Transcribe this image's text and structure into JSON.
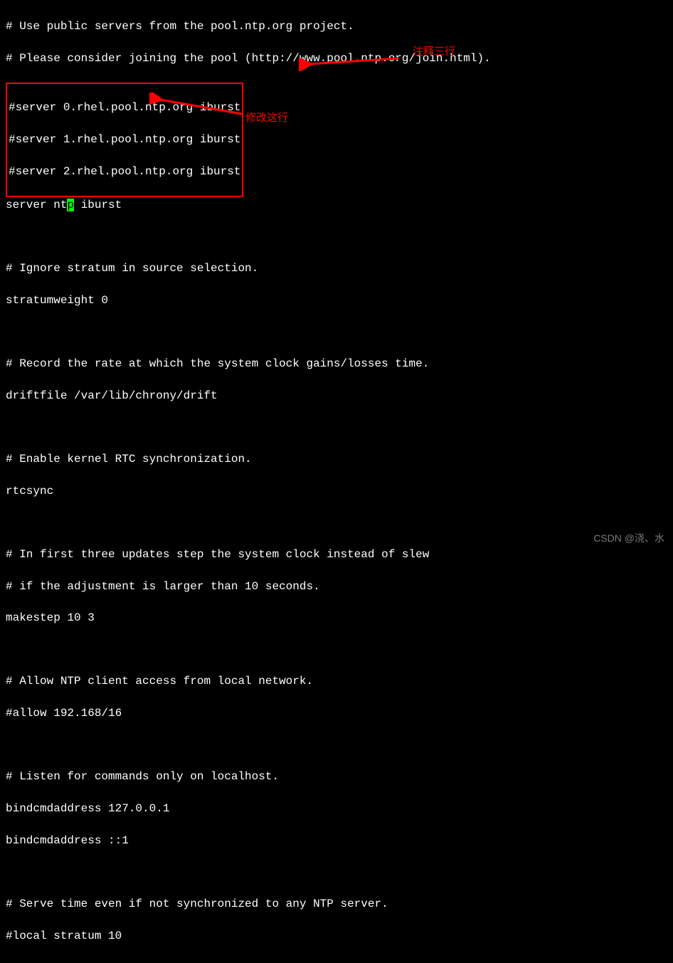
{
  "lines": {
    "l1": "# Use public servers from the pool.ntp.org project.",
    "l2": "# Please consider joining the pool (http://www.pool.ntp.org/join.html).",
    "boxed1": "#server 0.rhel.pool.ntp.org iburst",
    "boxed2": "#server 1.rhel.pool.ntp.org iburst",
    "boxed3": "#server 2.rhel.pool.ntp.org iburst",
    "l6_pre": "server nt",
    "l6_cursor": "p",
    "l6_post": " iburst",
    "l7": "",
    "l8": "# Ignore stratum in source selection.",
    "l9": "stratumweight 0",
    "l10": "",
    "l11": "# Record the rate at which the system clock gains/losses time.",
    "l12": "driftfile /var/lib/chrony/drift",
    "l13": "",
    "l14": "# Enable kernel RTC synchronization.",
    "l15": "rtcsync",
    "l16": "",
    "l17": "# In first three updates step the system clock instead of slew",
    "l18": "# if the adjustment is larger than 10 seconds.",
    "l19": "makestep 10 3",
    "l20": "",
    "l21": "# Allow NTP client access from local network.",
    "l22": "#allow 192.168/16",
    "l23": "",
    "l24": "# Listen for commands only on localhost.",
    "l25": "bindcmdaddress 127.0.0.1",
    "l26": "bindcmdaddress ::1",
    "l27": "",
    "l28": "# Serve time even if not synchronized to any NTP server.",
    "l29": "#local stratum 10"
  },
  "annotations": {
    "top": "注释三行",
    "mid": "修改这行"
  },
  "watermark": "CSDN @浇、水"
}
